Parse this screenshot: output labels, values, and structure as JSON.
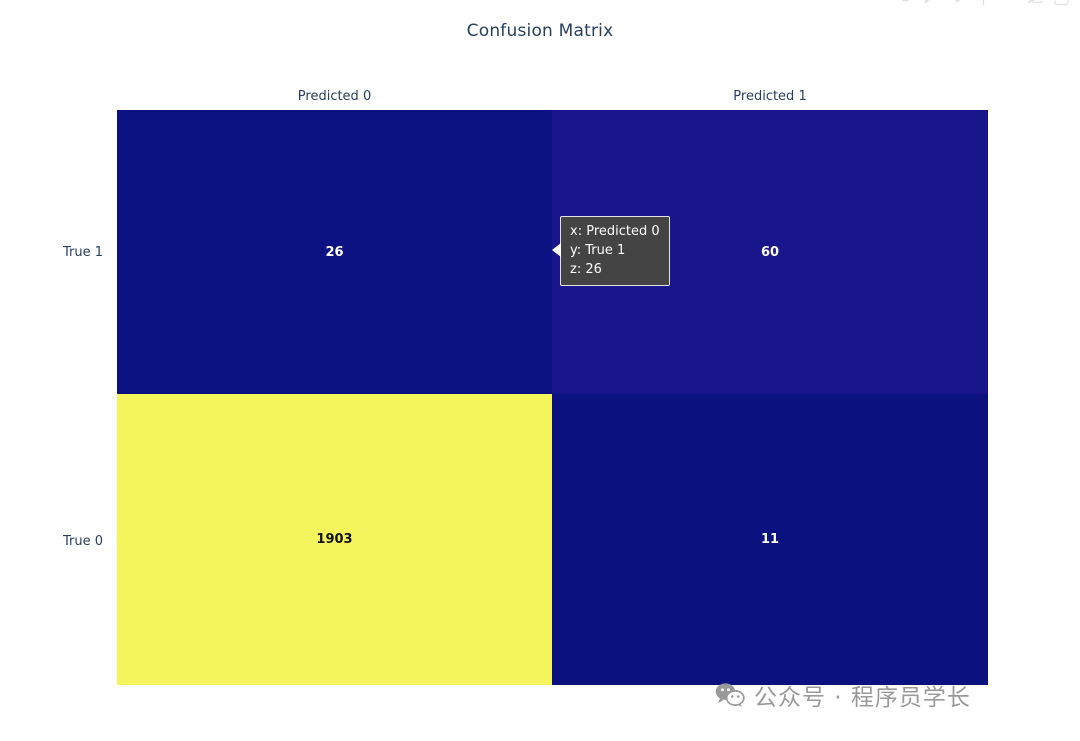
{
  "chart_data": {
    "type": "heatmap",
    "title": "Confusion Matrix",
    "xlabel": "",
    "ylabel": "",
    "categories": [
      "Predicted 0",
      "Predicted 1"
    ],
    "rows": [
      "True 1",
      "True 0"
    ],
    "cells": [
      [
        {
          "x": "Predicted 0",
          "y": "True 1",
          "z": 26,
          "display": "26",
          "fill": "#0d1282",
          "text_color": "#ffffff"
        },
        {
          "x": "Predicted 1",
          "y": "True 1",
          "z": 60,
          "display": "60",
          "fill": "#19168c",
          "text_color": "#ffffff"
        }
      ],
      [
        {
          "x": "Predicted 0",
          "y": "True 0",
          "z": 1903,
          "display": "1903",
          "fill": "#f4f45d",
          "text_color": "#111111"
        },
        {
          "x": "Predicted 1",
          "y": "True 0",
          "z": 11,
          "display": "11",
          "fill": "#0c1180",
          "text_color": "#ffffff"
        }
      ]
    ],
    "zmin": 11,
    "zmax": 1903,
    "colorscale": "Viridis",
    "grid": false,
    "legend": "none",
    "colors": {
      "title_text": "#2a3f5f",
      "axis_text": "#2a3f5f",
      "background": "#ffffff",
      "low": "#0c1180",
      "high": "#f4f45d"
    }
  },
  "title": "Confusion Matrix",
  "axes": {
    "x_tick_labels": [
      "Predicted 0",
      "Predicted 1"
    ],
    "y_tick_labels": [
      "True 1",
      "True 0"
    ]
  },
  "cell_values": {
    "r0c0": "26",
    "r0c1": "60",
    "r1c0": "1903",
    "r1c1": "11"
  },
  "tooltip": {
    "x_line": "x: Predicted 0",
    "y_line": "y: True 1",
    "z_line": "z: 26"
  },
  "modebar": {
    "buttons": [
      {
        "name": "camera-icon",
        "title": "Download plot as a png"
      },
      {
        "name": "zoom-icon",
        "title": "Zoom"
      },
      {
        "name": "pan-icon",
        "title": "Pan"
      },
      {
        "name": "zoom-in-icon",
        "title": "Zoom in"
      },
      {
        "name": "zoom-out-icon",
        "title": "Zoom out"
      },
      {
        "name": "autoscale-icon",
        "title": "Autoscale"
      },
      {
        "name": "reset-axes-icon",
        "title": "Reset axes"
      }
    ]
  },
  "watermark": {
    "text": "公众号 · 程序员学长",
    "icon": "wechat-icon"
  }
}
